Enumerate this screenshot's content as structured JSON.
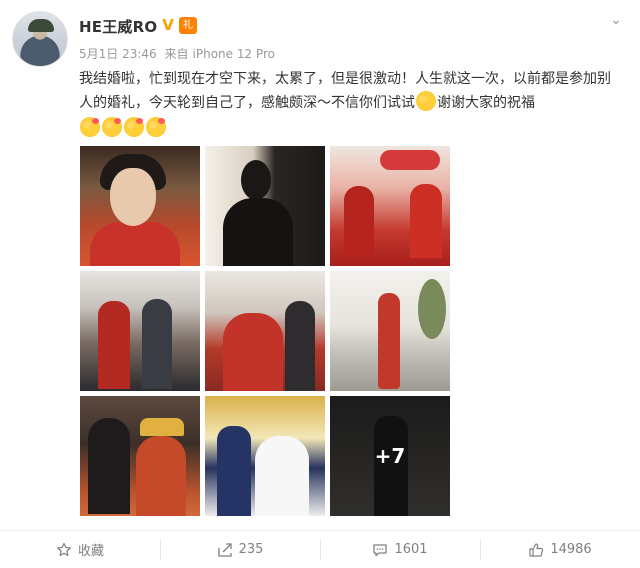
{
  "user": {
    "name": "HE王威RO",
    "verified_badge": "V",
    "gift_badge": "礼"
  },
  "meta": {
    "date": "5月1日 23:46",
    "source_prefix": "来自",
    "source": "iPhone 12 Pro"
  },
  "post": {
    "text_part1": "我结婚啦，忙到现在才空下来，太累了，但是很激动！人生就这一次，以前都是参加别人的婚礼，今天轮到自己了，感触颇深～不信你们试试",
    "text_part2": "谢谢大家的祝福",
    "emojis": [
      "kiss-emoji",
      "kiss-emoji",
      "kiss-emoji",
      "kiss-emoji"
    ]
  },
  "photos": {
    "count_visible": 9,
    "more_label": "+7"
  },
  "actions": {
    "favorite_label": "收藏",
    "repost_count": "235",
    "comment_count": "1601",
    "like_count": "14986"
  },
  "colors": {
    "accent_orange": "#ff8200",
    "text_gray": "#999999",
    "text_dark": "#333333"
  }
}
